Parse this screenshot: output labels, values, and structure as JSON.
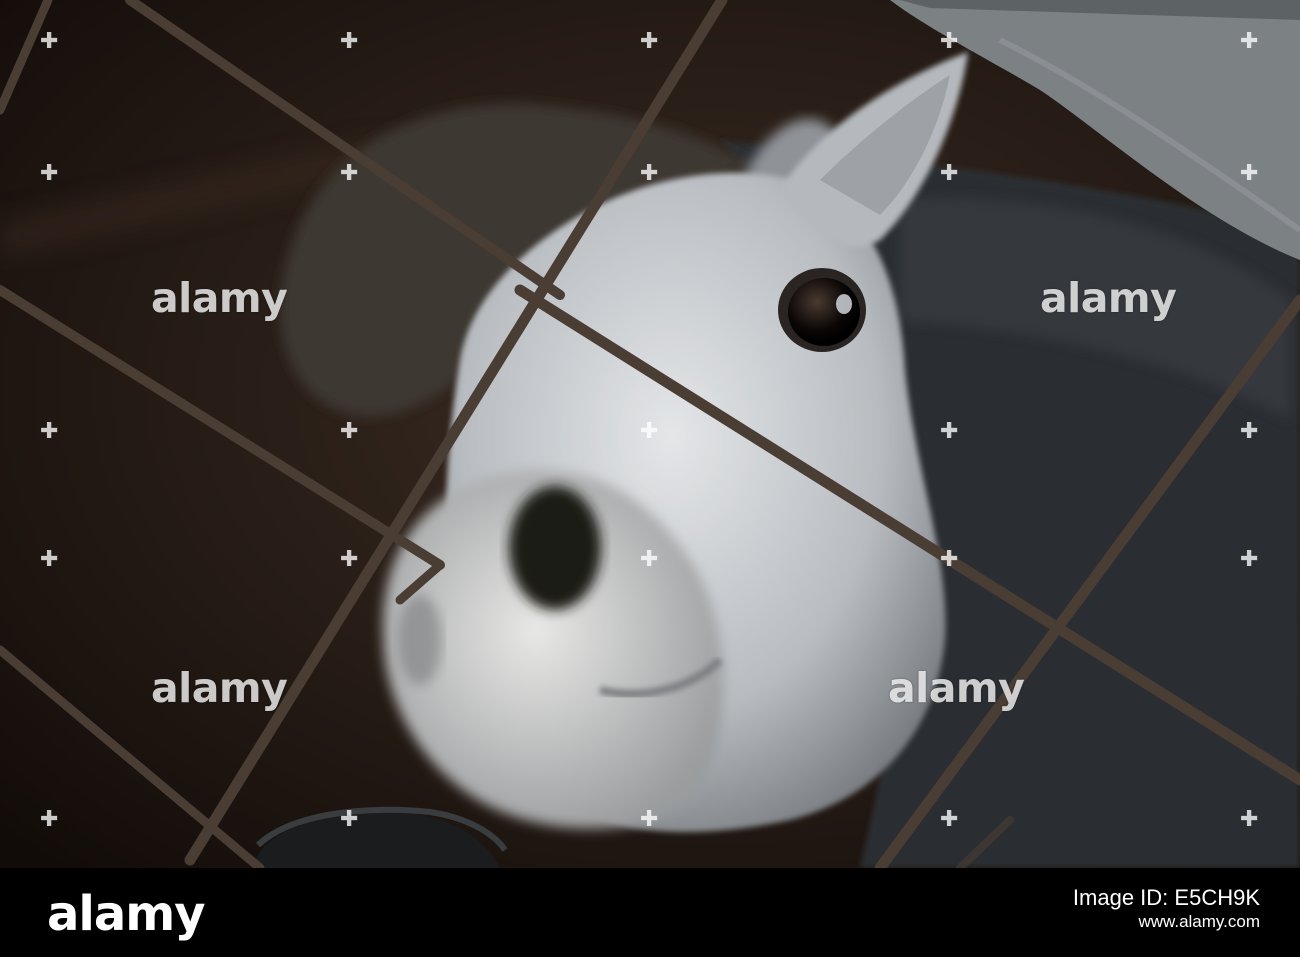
{
  "watermark": {
    "text": "alamy",
    "marker_glyph": "✚"
  },
  "footer": {
    "logo": "alamy",
    "image_id_label": "Image ID: E5CH9K",
    "site": "www.alamy.com"
  },
  "colors": {
    "background": "#1f1712",
    "coat": "#c9cbce",
    "bars": "#4a3d33",
    "footer": "#000000"
  }
}
